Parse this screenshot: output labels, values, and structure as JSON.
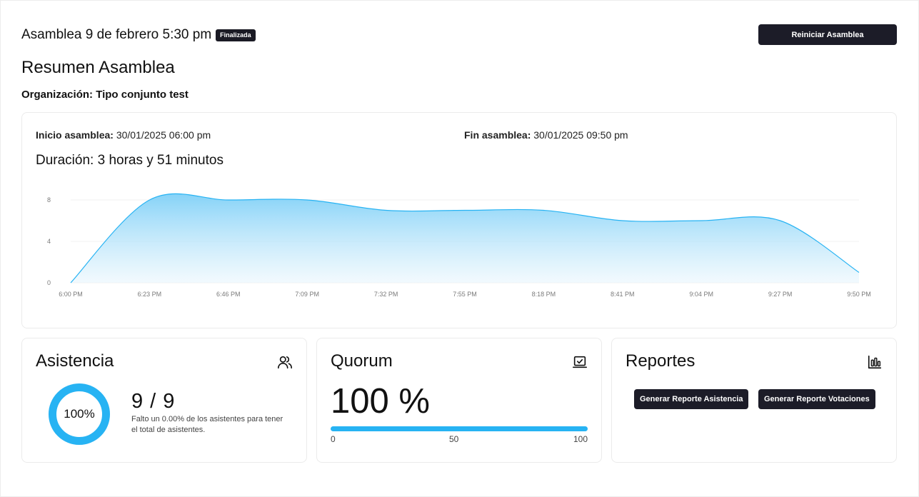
{
  "header": {
    "title": "Asamblea 9 de febrero 5:30 pm",
    "badge": "Finalizada",
    "restart_label": "Reiniciar Asamblea"
  },
  "summary": {
    "title": "Resumen Asamblea",
    "org_label": "Organización:",
    "org_name": "Tipo conjunto test"
  },
  "timing": {
    "start_label": "Inicio asamblea:",
    "start_value": "30/01/2025 06:00 pm",
    "end_label": "Fin asamblea:",
    "end_value": "30/01/2025 09:50 pm",
    "duration": "Duración: 3 horas y 51 minutos"
  },
  "chart_data": {
    "type": "area",
    "x": [
      "6:00 PM",
      "6:23 PM",
      "6:46 PM",
      "7:09 PM",
      "7:32 PM",
      "7:55 PM",
      "8:18 PM",
      "8:41 PM",
      "9:04 PM",
      "9:27 PM",
      "9:50 PM"
    ],
    "values": [
      0,
      8,
      8,
      8,
      7,
      7,
      7,
      6,
      6,
      6,
      1
    ],
    "y_ticks": [
      "0",
      "4",
      "8"
    ],
    "ylim": [
      0,
      8
    ],
    "grid": true,
    "color": "#27b3f3"
  },
  "attendance": {
    "title": "Asistencia",
    "icon": "users-icon",
    "ring_label": "100%",
    "ring_fraction": 1.0,
    "count": "9 / 9",
    "note": "Falto un 0.00% de los asistentes para tener el total de asistentes."
  },
  "quorum": {
    "title": "Quorum",
    "icon": "quorum-check-icon",
    "value": "100 %",
    "fraction": 1.0,
    "ticks": [
      "0",
      "50",
      "100"
    ]
  },
  "reports": {
    "title": "Reportes",
    "icon": "bar-chart-icon",
    "btn_attendance": "Generar Reporte Asistencia",
    "btn_votes": "Generar Reporte Votaciones"
  },
  "colors": {
    "accent": "#27b3f3",
    "dark": "#1c1c28"
  }
}
